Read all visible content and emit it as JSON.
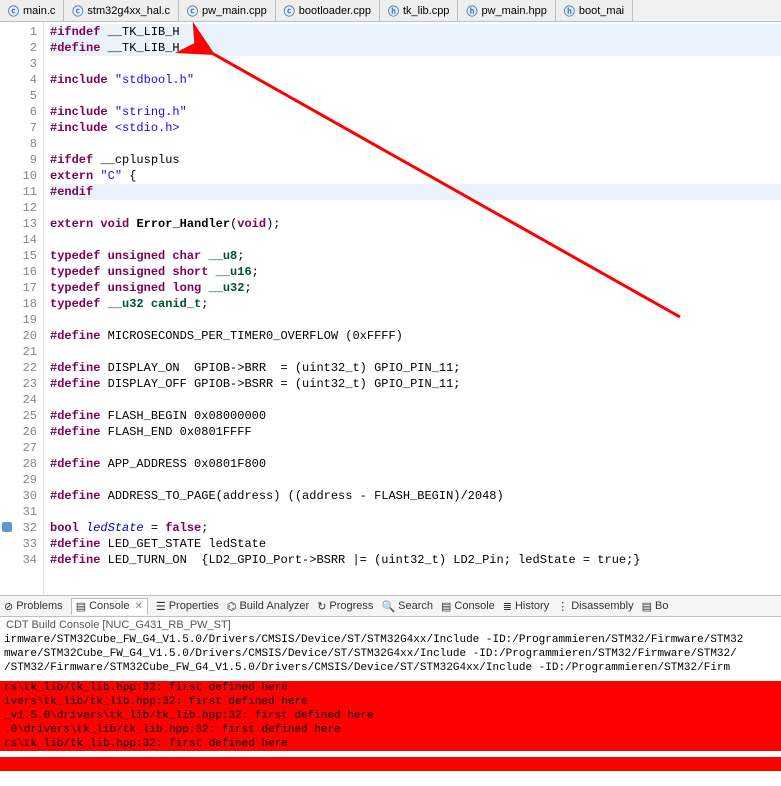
{
  "tabs": [
    {
      "icon": "c",
      "label": "main.c"
    },
    {
      "icon": "c",
      "label": "stm32g4xx_hal.c"
    },
    {
      "icon": "c",
      "label": "pw_main.cpp"
    },
    {
      "icon": "c",
      "label": "bootloader.cpp"
    },
    {
      "icon": "h",
      "label": "tk_lib.cpp"
    },
    {
      "icon": "h",
      "label": "pw_main.hpp"
    },
    {
      "icon": "h",
      "label": "boot_mai"
    }
  ],
  "lines": [
    {
      "n": 1,
      "hl": true,
      "html": "<span class='kw'>#ifndef</span> __TK_LIB_H"
    },
    {
      "n": 2,
      "hl": true,
      "html": "<span class='kw'>#define</span> __TK_LIB_H"
    },
    {
      "n": 3,
      "hl": false,
      "html": ""
    },
    {
      "n": 4,
      "hl": false,
      "html": "<span class='kw'>#include</span> <span class='str'>\"stdbool.h\"</span>"
    },
    {
      "n": 5,
      "hl": false,
      "html": ""
    },
    {
      "n": 6,
      "hl": false,
      "html": "<span class='kw'>#include</span> <span class='str'>\"string.h\"</span>"
    },
    {
      "n": 7,
      "hl": false,
      "html": "<span class='kw'>#include</span> <span class='str'>&lt;stdio.h&gt;</span>"
    },
    {
      "n": 8,
      "hl": false,
      "html": ""
    },
    {
      "n": 9,
      "hl": false,
      "html": "<span class='kw'>#ifdef</span> __cplusplus"
    },
    {
      "n": 10,
      "hl": false,
      "html": "<span class='kw'>extern</span> <span class='str'>\"C\"</span> {"
    },
    {
      "n": 11,
      "hl": true,
      "html": "<span class='kw'>#endif</span>"
    },
    {
      "n": 12,
      "hl": false,
      "html": ""
    },
    {
      "n": 13,
      "hl": false,
      "html": "<span class='kw'>extern</span> <span class='kw'>void</span> <span class='mac'>Error_Handler</span>(<span class='kw'>void</span>);"
    },
    {
      "n": 14,
      "hl": false,
      "html": ""
    },
    {
      "n": 15,
      "hl": false,
      "html": "<span class='kw'>typedef</span> <span class='kw'>unsigned char</span> <span class='typ'>__u8</span>;"
    },
    {
      "n": 16,
      "hl": false,
      "html": "<span class='kw'>typedef</span> <span class='kw'>unsigned short</span> <span class='typ'>__u16</span>;"
    },
    {
      "n": 17,
      "hl": false,
      "html": "<span class='kw'>typedef</span> <span class='kw'>unsigned long</span> <span class='typ'>__u32</span>;"
    },
    {
      "n": 18,
      "hl": false,
      "html": "<span class='kw'>typedef</span> <span class='typ'>__u32</span> <span class='typ'>canid_t</span>;"
    },
    {
      "n": 19,
      "hl": false,
      "html": ""
    },
    {
      "n": 20,
      "hl": false,
      "html": "<span class='kw'>#define</span> MICROSECONDS_PER_TIMER0_OVERFLOW (0xFFFF)"
    },
    {
      "n": 21,
      "hl": false,
      "html": ""
    },
    {
      "n": 22,
      "hl": false,
      "html": "<span class='kw'>#define</span> DISPLAY_ON  GPIOB-&gt;BRR  = (uint32_t) GPIO_PIN_11;"
    },
    {
      "n": 23,
      "hl": false,
      "html": "<span class='kw'>#define</span> DISPLAY_OFF GPIOB-&gt;BSRR = (uint32_t) GPIO_PIN_11;"
    },
    {
      "n": 24,
      "hl": false,
      "html": ""
    },
    {
      "n": 25,
      "hl": false,
      "html": "<span class='kw'>#define</span> FLASH_BEGIN 0x08000000"
    },
    {
      "n": 26,
      "hl": false,
      "html": "<span class='kw'>#define</span> FLASH_END 0x0801FFFF"
    },
    {
      "n": 27,
      "hl": false,
      "html": ""
    },
    {
      "n": 28,
      "hl": false,
      "html": "<span class='kw'>#define</span> APP_ADDRESS 0x0801F800"
    },
    {
      "n": 29,
      "hl": false,
      "html": ""
    },
    {
      "n": 30,
      "hl": false,
      "html": "<span class='kw'>#define</span> ADDRESS_TO_PAGE(address) ((address - FLASH_BEGIN)/2048)"
    },
    {
      "n": 31,
      "hl": false,
      "html": ""
    },
    {
      "n": 32,
      "hl": false,
      "html": "<span class='kw'>bool</span> <span class='ital'>ledState</span> = <span class='kw'>false</span>;",
      "mark": true
    },
    {
      "n": 33,
      "hl": false,
      "html": "<span class='kw'>#define</span> LED_GET_STATE ledState"
    },
    {
      "n": 34,
      "hl": false,
      "html": "<span class='kw'>#define</span> LED_TURN_ON  {LD2_GPIO_Port-&gt;BSRR |= (uint32_t) LD2_Pin; ledState = true;}"
    }
  ],
  "panel": {
    "tabs": [
      {
        "label": "Problems",
        "icon": "⊘"
      },
      {
        "label": "Console",
        "icon": "▤",
        "active": true
      },
      {
        "label": "Properties",
        "icon": "☰"
      },
      {
        "label": "Build Analyzer",
        "icon": "⌬"
      },
      {
        "label": "Progress",
        "icon": "↻"
      },
      {
        "label": "Search",
        "icon": "🔍"
      },
      {
        "label": "Console",
        "icon": "▤"
      },
      {
        "label": "History",
        "icon": "≣"
      },
      {
        "label": "Disassembly",
        "icon": "⋮"
      },
      {
        "label": "Bo",
        "icon": "▤"
      }
    ],
    "title": "CDT Build Console [NUC_G431_RB_PW_ST]",
    "lines": [
      {
        "cls": "",
        "text": "irmware/STM32Cube_FW_G4_V1.5.0/Drivers/CMSIS/Device/ST/STM32G4xx/Include -ID:/Programmieren/STM32/Firmware/STM32"
      },
      {
        "cls": "",
        "text": "mware/STM32Cube_FW_G4_V1.5.0/Drivers/CMSIS/Device/ST/STM32G4xx/Include -ID:/Programmieren/STM32/Firmware/STM32/"
      },
      {
        "cls": "",
        "text": "/STM32/Firmware/STM32Cube_FW_G4_V1.5.0/Drivers/CMSIS/Device/ST/STM32G4xx/Include -ID:/Programmieren/STM32/Firm"
      }
    ],
    "errors": [
      "rs\\tk_lib/tk_lib.hpp:32: first defined here",
      "ivers\\tk_lib/tk_lib.hpp:32: first defined here",
      "_v1.5.0\\drivers\\tk_lib/tk_lib.hpp:32: first defined here",
      ".0\\drivers\\tk_lib/tk_lib.hpp:32: first defined here",
      "rs\\tk_lib/tk_lib.hpp:32: first defined here"
    ]
  }
}
